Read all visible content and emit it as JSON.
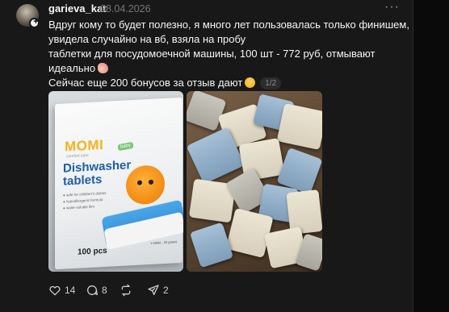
{
  "post": {
    "username": "garieva_kat",
    "date": "08.04.2026",
    "more_label": "···",
    "text_lines": [
      "Вдруг кому то будет полезно, я много лет пользовалась только финишем,",
      "увидела случайно на вб, взяла на пробу",
      "таблетки для посудомоечной машины, 100 шт - 772 руб, отмывают",
      "идеально",
      "Сейчас еще 200 бонусов за отзыв дают"
    ],
    "image_counter": "1/2",
    "images": [
      {
        "brand": "MOMI",
        "brand_sub": "comfort care",
        "badge": "baby",
        "title_line1": "Dishwasher",
        "title_line2": "tablets",
        "bullets": [
          "● safe for children's dishes",
          "● hypoallergenic formula",
          "● water-soluble film"
        ],
        "count": "100 pcs",
        "tiny_text": "1 tablet - 20 grams"
      },
      {}
    ]
  },
  "actions": {
    "likes": "14",
    "comments": "8",
    "shares": "2"
  },
  "colors": {
    "background": "#181818",
    "text": "#f3f5f7",
    "muted": "#777777"
  }
}
